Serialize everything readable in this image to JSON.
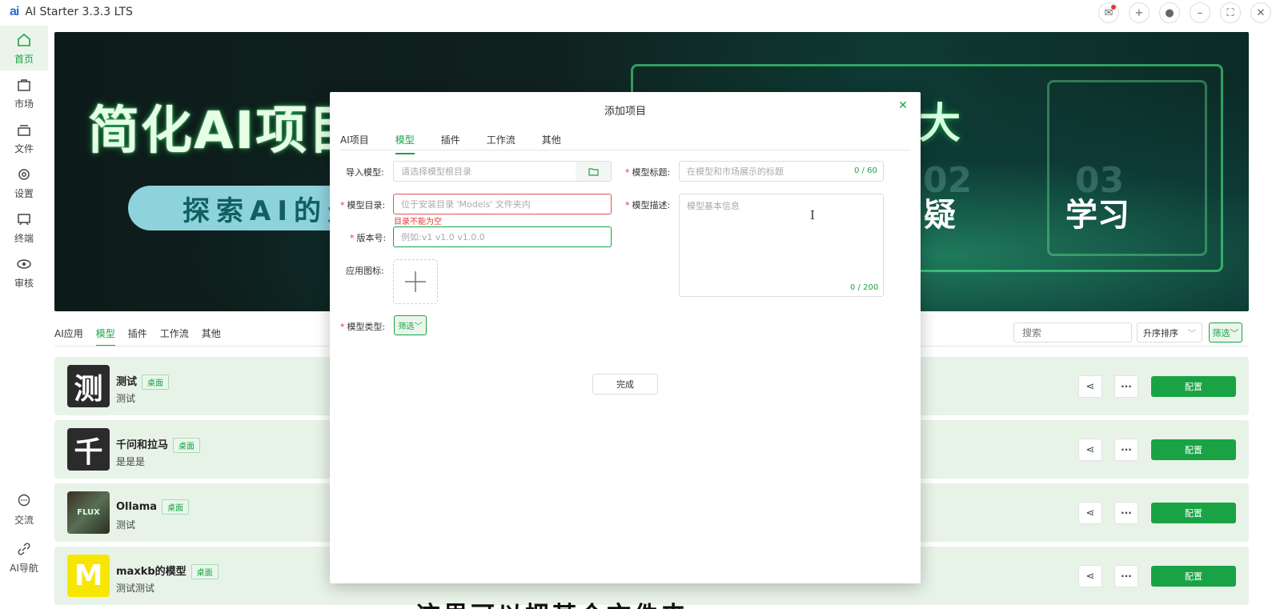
{
  "app": {
    "logo": "ai",
    "title": "AI Starter 3.3.3 LTS"
  },
  "window_controls": [
    {
      "name": "mail-icon",
      "glyph": "✉"
    },
    {
      "name": "add-icon",
      "glyph": "+"
    },
    {
      "name": "user-icon",
      "glyph": "●"
    },
    {
      "name": "minimize-icon",
      "glyph": "–"
    },
    {
      "name": "fullscreen-icon",
      "glyph": "⛶"
    },
    {
      "name": "close-icon",
      "glyph": "✕"
    }
  ],
  "sidebar": {
    "items": [
      {
        "label": "首页",
        "icon": "home-icon",
        "active": true
      },
      {
        "label": "市场",
        "icon": "market-icon"
      },
      {
        "label": "文件",
        "icon": "files-icon"
      },
      {
        "label": "设置",
        "icon": "gear-icon"
      },
      {
        "label": "终端",
        "icon": "terminal-icon"
      },
      {
        "label": "审核",
        "icon": "eye-icon"
      }
    ],
    "bottom_items": [
      {
        "label": "交流",
        "icon": "chat-icon"
      },
      {
        "label": "AI导航",
        "icon": "link-icon"
      }
    ]
  },
  "banner": {
    "headline": "简化AI项目",
    "headline_right": "大",
    "pill_text": "探索AI的天",
    "word_1": "疑",
    "word_2": "学习",
    "num_1": "02",
    "num_2": "03"
  },
  "content": {
    "tabs": [
      "AI应用",
      "模型",
      "插件",
      "工作流",
      "其他"
    ],
    "active_tab": 1,
    "search_placeholder": "搜索",
    "sort_label": "升序排序",
    "filter_label": "筛选"
  },
  "cards": [
    {
      "avatar": "测",
      "name": "测试",
      "badge": "桌面",
      "desc": "测试",
      "action": "配置"
    },
    {
      "avatar": "千",
      "name": "千问和拉马",
      "badge": "桌面",
      "desc": "是是是",
      "action": "配置"
    },
    {
      "avatar": "FLUX",
      "name": "Ollama",
      "badge": "桌面",
      "desc": "测试",
      "action": "配置"
    },
    {
      "avatar": "M",
      "name": "maxkb的模型",
      "badge": "桌面",
      "desc": "测试测试",
      "action": "配置"
    }
  ],
  "modal": {
    "title": "添加项目",
    "tabs": [
      "AI项目",
      "模型",
      "插件",
      "工作流",
      "其他"
    ],
    "active_tab": 1,
    "fields": {
      "import_label": "导入模型:",
      "import_placeholder": "请选择模型根目录",
      "dir_label": "模型目录:",
      "dir_placeholder": "位于安装目录 'Models' 文件夹内",
      "dir_error": "目录不能为空",
      "version_label": "版本号:",
      "version_placeholder": "例如:v1 v1.0 v1.0.0",
      "icon_label": "应用图标:",
      "type_label": "模型类型:",
      "type_value": "筛选",
      "title_label": "模型标题:",
      "title_placeholder": "在模型和市场展示的标题",
      "title_counter": "0 / 60",
      "desc_label": "模型描述:",
      "desc_placeholder": "模型基本信息",
      "desc_counter": "0 / 200"
    },
    "done_label": "完成"
  },
  "subtitle_overlay": "这里可以把某个文件夹"
}
